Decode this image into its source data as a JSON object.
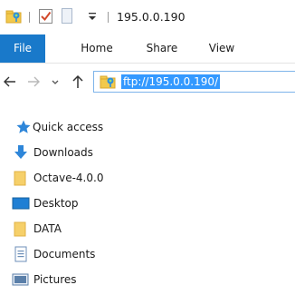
{
  "window": {
    "title": "195.0.0.190"
  },
  "quick_access_toolbar": {
    "items": [
      {
        "icon": "folder-icon"
      },
      {
        "icon": "properties-checkmark-icon"
      },
      {
        "icon": "new-folder-icon"
      },
      {
        "icon": "customize-dropdown-icon"
      }
    ]
  },
  "ribbon": {
    "tabs": [
      {
        "label": "File",
        "active": true
      },
      {
        "label": "Home"
      },
      {
        "label": "Share"
      },
      {
        "label": "View"
      }
    ],
    "file_tab_color": "#1979ca"
  },
  "address_bar": {
    "path": "ftp://195.0.0.190/",
    "selected": true,
    "selection_color": "#3399ff",
    "border_color": "#7eb4ea"
  },
  "nav_buttons": [
    {
      "icon": "back-arrow-icon",
      "enabled": true
    },
    {
      "icon": "forward-arrow-icon",
      "enabled": false
    },
    {
      "icon": "recent-locations-chevron-icon",
      "enabled": true
    },
    {
      "icon": "up-arrow-icon",
      "enabled": true
    }
  ],
  "navigation_pane": {
    "items": [
      {
        "label": "Quick access",
        "icon": "star-icon"
      },
      {
        "label": "Downloads",
        "icon": "download-arrow-icon"
      },
      {
        "label": "Octave-4.0.0",
        "icon": "folder-icon"
      },
      {
        "label": "Desktop",
        "icon": "desktop-icon"
      },
      {
        "label": "DATA",
        "icon": "folder-icon"
      },
      {
        "label": "Documents",
        "icon": "documents-icon"
      },
      {
        "label": "Pictures",
        "icon": "pictures-icon"
      }
    ]
  }
}
